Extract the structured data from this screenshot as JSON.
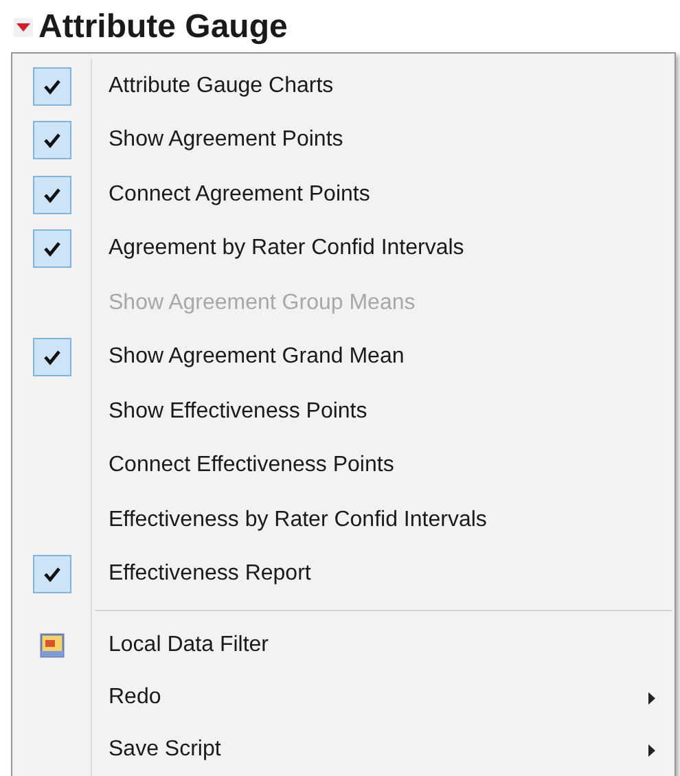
{
  "header": {
    "title": "Attribute Gauge"
  },
  "menu": {
    "items": [
      {
        "kind": "check",
        "label": "Attribute Gauge Charts",
        "checked": true,
        "disabled": false
      },
      {
        "kind": "check",
        "label": "Show Agreement Points",
        "checked": true,
        "disabled": false
      },
      {
        "kind": "check",
        "label": "Connect Agreement Points",
        "checked": true,
        "disabled": false
      },
      {
        "kind": "check",
        "label": "Agreement by Rater Confid Intervals",
        "checked": true,
        "disabled": false
      },
      {
        "kind": "check",
        "label": "Show Agreement Group Means",
        "checked": false,
        "disabled": true
      },
      {
        "kind": "check",
        "label": "Show Agreement Grand Mean",
        "checked": true,
        "disabled": false
      },
      {
        "kind": "check",
        "label": "Show Effectiveness Points",
        "checked": false,
        "disabled": false
      },
      {
        "kind": "check",
        "label": "Connect Effectiveness Points",
        "checked": false,
        "disabled": false
      },
      {
        "kind": "check",
        "label": "Effectiveness by Rater Confid Intervals",
        "checked": false,
        "disabled": false
      },
      {
        "kind": "check",
        "label": "Effectiveness Report",
        "checked": true,
        "disabled": false
      },
      {
        "kind": "separator"
      },
      {
        "kind": "icon",
        "label": "Local Data Filter"
      },
      {
        "kind": "submenu",
        "label": "Redo"
      },
      {
        "kind": "submenu",
        "label": "Save Script"
      }
    ]
  }
}
